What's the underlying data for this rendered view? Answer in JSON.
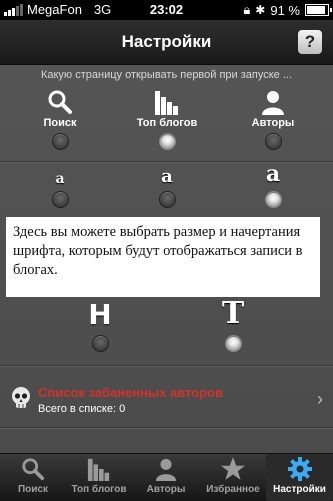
{
  "status_bar": {
    "carrier": "MegaFon",
    "network": "3G",
    "time": "23:02",
    "battery_percent": "91 %",
    "battery_level": 0.91
  },
  "nav": {
    "title": "Настройки",
    "help_label": "?"
  },
  "start_page": {
    "hint": "Какую страницу открывать первой при запуске ...",
    "options": [
      {
        "label": "Поиск",
        "icon": "search-icon",
        "selected": false
      },
      {
        "label": "Топ блогов",
        "icon": "bar-chart-icon",
        "selected": true
      },
      {
        "label": "Авторы",
        "icon": "person-icon",
        "selected": false
      }
    ]
  },
  "font_size": {
    "options": [
      {
        "glyph": "a",
        "selected": false
      },
      {
        "glyph": "a",
        "selected": false
      },
      {
        "glyph": "a",
        "selected": true
      }
    ]
  },
  "tooltip": {
    "text": "Здесь вы можете выбрать размер и начертания шрифта, которым будут отображаться записи в блогах."
  },
  "font_style": {
    "options": [
      {
        "glyph": "H",
        "selected": false
      },
      {
        "glyph": "T",
        "selected": true
      }
    ]
  },
  "banned": {
    "title": "Список забаненных авторов",
    "count_text": "Всего в списке: 0",
    "icon": "skull-icon"
  },
  "tabs": [
    {
      "label": "Поиск",
      "icon": "search-icon",
      "active": false
    },
    {
      "label": "Топ блогов",
      "icon": "bar-chart-icon",
      "active": false
    },
    {
      "label": "Авторы",
      "icon": "person-icon",
      "active": false
    },
    {
      "label": "Избранное",
      "icon": "star-icon",
      "active": false
    },
    {
      "label": "Настройки",
      "icon": "gear-icon",
      "active": true
    }
  ],
  "colors": {
    "accent_red": "#d0342c",
    "active_tab_blue": "#3fa9f5"
  }
}
